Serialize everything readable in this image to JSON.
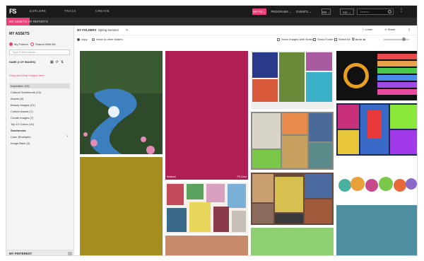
{
  "brand": {
    "logo": "FS"
  },
  "topnav": {
    "items": [
      "EXPLORE",
      "TRACK",
      "CREATE"
    ],
    "my_fs": "MY FS ⌄",
    "programs": "PROGRAMS ⌄",
    "events": "EVENTS ⌄",
    "lang": "EN ⌄",
    "scope": "ALL ⌄",
    "search_placeholder": "Search..."
  },
  "subnav": {
    "tabs": [
      "MY ASSETS",
      "MY REPORTS"
    ]
  },
  "sidebar": {
    "title": "MY ASSETS",
    "radio_my": "My Folders",
    "radio_shared": "Shared With Me",
    "input_placeholder": "Type Folder Name...",
    "sort_label": "NAME (# OF IMAGES)",
    "drag_hint": "Drag and Drop Images here",
    "folders": [
      "Inspiration (10)",
      "Cultural Sentiments (19)",
      "Assets (8)",
      "Beauty Images (21)",
      "Culture Assets (7)",
      "Create Images (7)",
      "Top 10 Colors (16)",
      "Sentiments",
      "Case (Example)",
      "Image Bank (4)"
    ],
    "bottom": "MY PINTEREST"
  },
  "header": {
    "my_folders": "MY FOLDERS",
    "folder_name": "Spring Summer",
    "learn": "Learn",
    "share": "Share"
  },
  "toolbar": {
    "copy": "copy",
    "move": "move to other folders",
    "show_notes": "Show Images With Notes",
    "show_footer": "Show Footer",
    "select_all": "Select All"
  },
  "tiles": {
    "seafood": "Seafood",
    "code": "FS Color"
  },
  "colors": {
    "accent": "#e8417a",
    "nav": "#1b1b1b"
  }
}
